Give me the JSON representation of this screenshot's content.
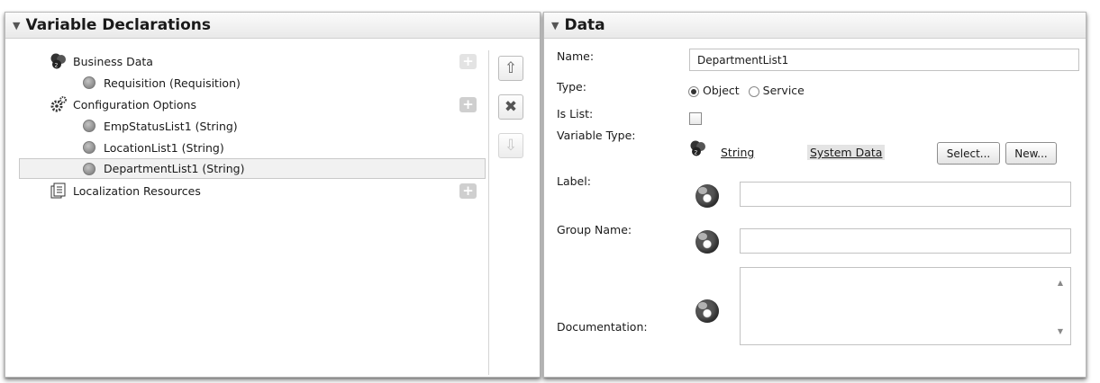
{
  "variables_panel": {
    "title": "Variable Declarations",
    "tree": [
      {
        "label": "Business Data",
        "icon": "business-data-icon",
        "add_button": true
      },
      {
        "label": "Requisition (Requisition)",
        "icon": "variable-dot-icon"
      },
      {
        "label": "Configuration Options",
        "icon": "gears-icon",
        "add_button": true
      },
      {
        "label": "EmpStatusList1 (String)",
        "icon": "variable-dot-icon"
      },
      {
        "label": "LocationList1 (String)",
        "icon": "variable-dot-icon"
      },
      {
        "label": "DepartmentList1 (String)",
        "icon": "variable-dot-icon",
        "selected": true
      },
      {
        "label": "Localization Resources",
        "icon": "resource-bundle-icon",
        "add_button": true
      }
    ],
    "side_buttons": [
      "move-up",
      "delete",
      "move-down"
    ]
  },
  "data_panel": {
    "title": "Data",
    "name_label": "Name:",
    "name_value": "DepartmentList1",
    "type_label": "Type:",
    "type_options": {
      "object": "Object",
      "service": "Service"
    },
    "type_selected": "Object",
    "is_list_label": "Is List:",
    "is_list_checked": false,
    "variable_type_label": "Variable Type:",
    "variable_type_value": "String",
    "system_data_link": "System Data",
    "select_button": "Select...",
    "new_button": "New...",
    "label_label": "Label:",
    "label_value": "",
    "group_name_label": "Group Name:",
    "group_name_value": "",
    "documentation_label": "Documentation:",
    "documentation_value": ""
  }
}
